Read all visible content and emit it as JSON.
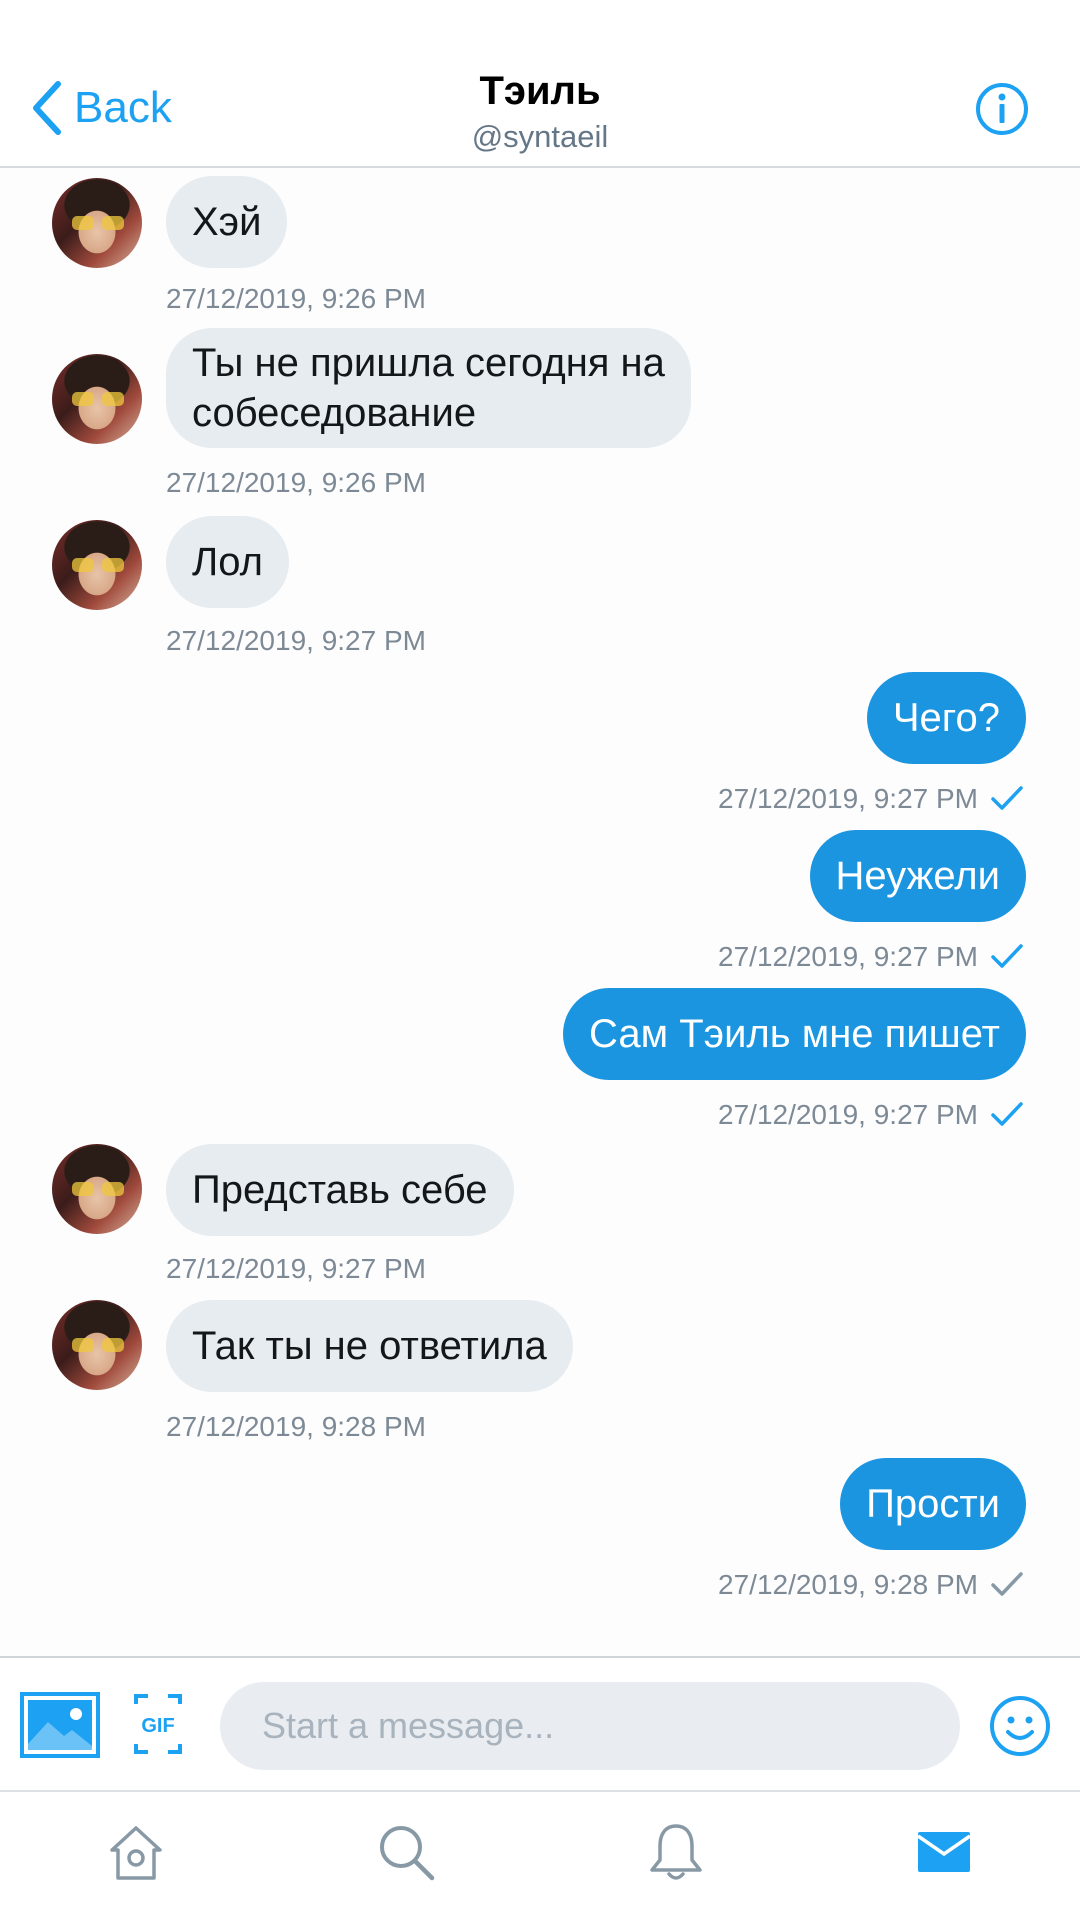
{
  "header": {
    "back_label": "Back",
    "title": "Тэиль",
    "handle": "@syntaeil",
    "info_icon": "info-icon"
  },
  "messages": [
    {
      "direction": "in",
      "text": "Хэй",
      "timestamp": "27/12/2019, 9:26 PM"
    },
    {
      "direction": "in",
      "text_lines": [
        "Ты не пришла сегодня на",
        "собеседование"
      ],
      "timestamp": "27/12/2019, 9:26 PM"
    },
    {
      "direction": "in",
      "text": "Лол",
      "timestamp": "27/12/2019, 9:27 PM"
    },
    {
      "direction": "out",
      "text": "Чего?",
      "timestamp": "27/12/2019, 9:27 PM",
      "read": true
    },
    {
      "direction": "out",
      "text": "Неужели",
      "timestamp": "27/12/2019, 9:27 PM",
      "read": true
    },
    {
      "direction": "out",
      "text": "Сам Тэиль мне пишет",
      "timestamp": "27/12/2019, 9:27 PM",
      "read": true
    },
    {
      "direction": "in",
      "text": "Представь себе",
      "timestamp": "27/12/2019, 9:27 PM"
    },
    {
      "direction": "in",
      "text": "Так ты не ответила",
      "timestamp": "27/12/2019, 9:28 PM"
    },
    {
      "direction": "out",
      "text": "Прости",
      "timestamp": "27/12/2019, 9:28 PM",
      "read": false
    }
  ],
  "composer": {
    "placeholder": "Start a message...",
    "photo_icon": "image-icon",
    "gif_icon": "gif-icon",
    "gif_text": "GIF",
    "emoji_icon": "smiley-icon"
  },
  "tabbar": {
    "items": [
      {
        "icon": "home-icon",
        "active": false
      },
      {
        "icon": "search-icon",
        "active": false
      },
      {
        "icon": "bell-icon",
        "active": false
      },
      {
        "icon": "mail-icon",
        "active": true
      }
    ]
  },
  "colors": {
    "accent": "#1da1f2",
    "outgoing_bubble": "#1b95e0",
    "incoming_bubble": "#e6ecf0",
    "read_check": "#1da1f2",
    "unread_check": "#8899a6",
    "tab_inactive": "#8899a6"
  }
}
